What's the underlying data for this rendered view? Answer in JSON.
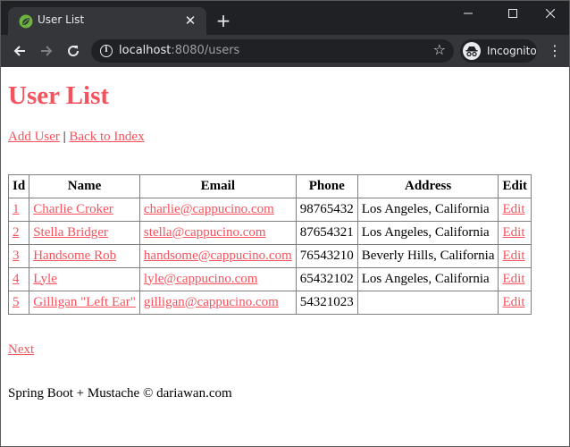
{
  "browser": {
    "tab_title": "User List",
    "url_host": "localhost",
    "url_rest": ":8080/users",
    "incognito_label": "Incognito"
  },
  "page": {
    "title": "User List",
    "links": {
      "add_user": "Add User",
      "separator": "|",
      "back_to_index": "Back to Index"
    },
    "table": {
      "headers": [
        "Id",
        "Name",
        "Email",
        "Phone",
        "Address",
        "Edit"
      ],
      "rows": [
        {
          "id": "1",
          "name": "Charlie Croker",
          "email": "charlie@cappucino.com",
          "phone": "98765432",
          "address": "Los Angeles, California",
          "edit": "Edit"
        },
        {
          "id": "2",
          "name": "Stella Bridger",
          "email": "stella@cappucino.com",
          "phone": "87654321",
          "address": "Los Angeles, California",
          "edit": "Edit"
        },
        {
          "id": "3",
          "name": "Handsome Rob",
          "email": "handsome@cappucino.com",
          "phone": "76543210",
          "address": "Beverly Hills, California",
          "edit": "Edit"
        },
        {
          "id": "4",
          "name": "Lyle",
          "email": "lyle@cappucino.com",
          "phone": "65432102",
          "address": "Los Angeles, California",
          "edit": "Edit"
        },
        {
          "id": "5",
          "name": "Gilligan \"Left Ear\"",
          "email": "gilligan@cappucino.com",
          "phone": "54321023",
          "address": "",
          "edit": "Edit"
        }
      ]
    },
    "next_label": "Next",
    "footer": "Spring Boot + Mustache © dariawan.com"
  },
  "colors": {
    "accent": "#f5525d",
    "chrome_dark": "#202124",
    "chrome_toolbar": "#35363a"
  },
  "icons": {
    "tab_favicon": "spring-leaf-icon",
    "tab_close": "close-icon",
    "new_tab": "plus-icon",
    "back": "arrow-left-icon",
    "forward": "arrow-right-icon",
    "reload": "reload-icon",
    "site_info": "info-icon",
    "bookmark": "star-icon",
    "incognito": "incognito-icon",
    "menu": "kebab-menu-icon"
  }
}
